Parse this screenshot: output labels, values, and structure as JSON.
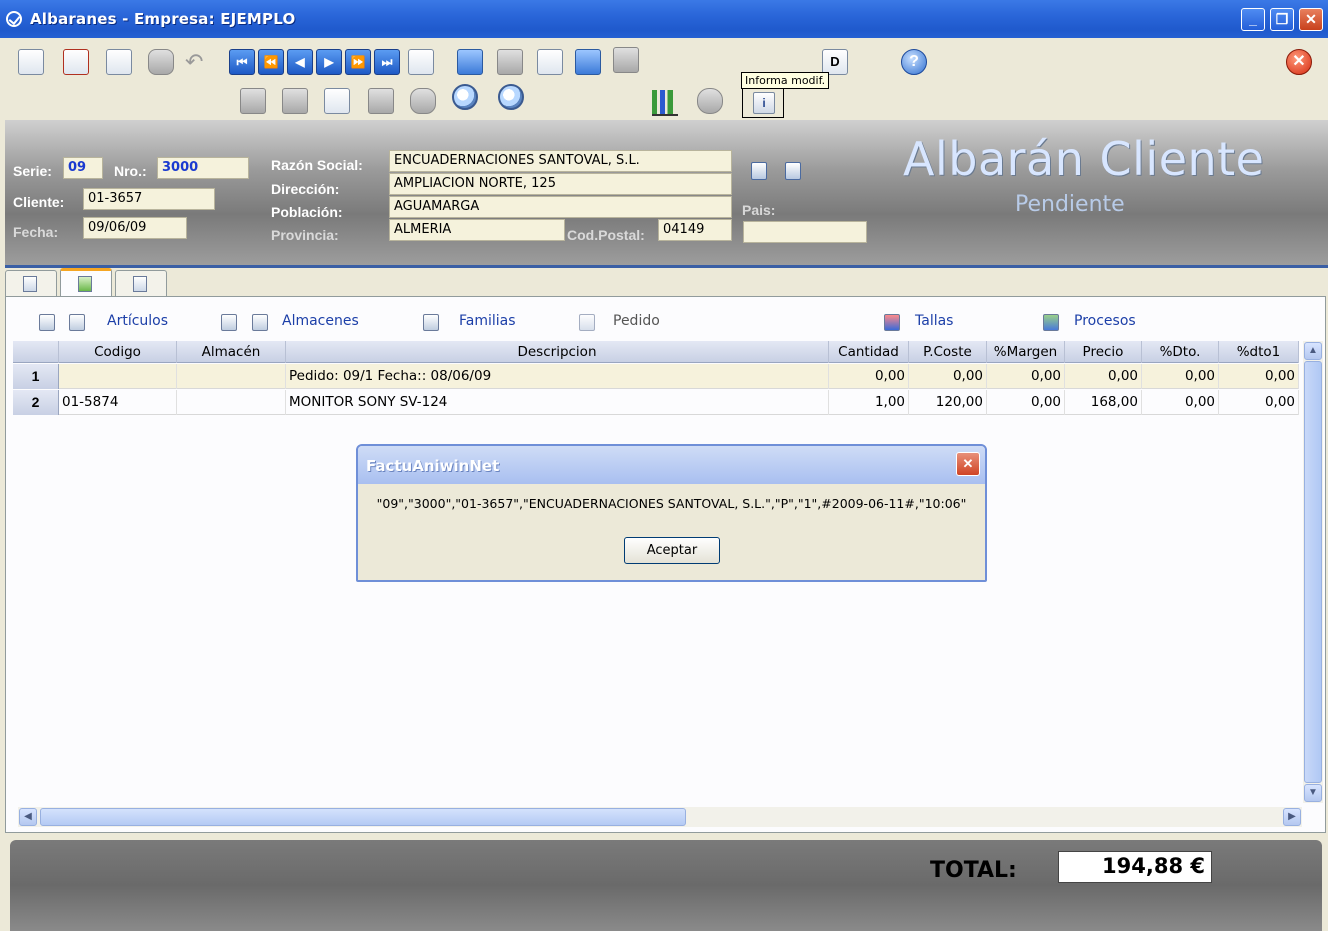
{
  "window": {
    "title": "Albaranes - Empresa: EJEMPLO",
    "minimize": "_",
    "restore": "❐",
    "close": "✕"
  },
  "toolbar": {
    "tooltip": "Informa modif.",
    "info_glyph": "i",
    "help_glyph": "?",
    "exit_glyph": "✕",
    "icons": [
      "new-doc-icon",
      "delete-doc-icon",
      "edit-doc-icon",
      "database-icon",
      "undo-icon",
      "first-record-icon",
      "previous-page-icon",
      "previous-record-icon",
      "next-record-icon",
      "next-page-icon",
      "last-record-icon",
      "eraser-icon",
      "window-icon",
      "printer-icon",
      "preview-icon",
      "report-icon",
      "link-icon",
      "doc-d-icon",
      "help-icon",
      "exit-icon",
      "add-line-icon",
      "grid-icon",
      "copy-icon",
      "paste-icon",
      "spellcheck-icon",
      "zoom-in-icon",
      "zoom-out-icon",
      "chart-icon",
      "info-icon"
    ]
  },
  "header": {
    "serie_label": "Serie:",
    "serie_value": "09",
    "nro_label": "Nro.:",
    "nro_value": "3000",
    "cliente_label": "Cliente:",
    "cliente_value": "01-3657",
    "fecha_label": "Fecha:",
    "fecha_value": "09/06/09",
    "razon_label": "Razón Social:",
    "razon_value": "ENCUADERNACIONES SANTOVAL, S.L.",
    "direccion_label": "Dirección:",
    "direccion_value": "AMPLIACION NORTE, 125",
    "poblacion_label": "Población:",
    "poblacion_value": "AGUAMARGA",
    "provincia_label": "Provincia:",
    "provincia_value": "ALMERIA",
    "codpostal_label": "Cod.Postal:",
    "codpostal_value": "04149",
    "pais_label": "Pais:",
    "pais_value": "",
    "doc_title": "Albarán Cliente",
    "doc_status": "Pendiente"
  },
  "links": {
    "articulos": "Artículos",
    "almacenes": "Almacenes",
    "familias": "Familias",
    "pedido": "Pedido",
    "tallas": "Tallas",
    "procesos": "Procesos"
  },
  "grid": {
    "columns": [
      "Codigo",
      "Almacén",
      "Descripcion",
      "Cantidad",
      "P.Coste",
      "%Margen",
      "Precio",
      "%Dto.",
      "%dto1"
    ],
    "rows": [
      {
        "num": "1",
        "codigo": "",
        "almacen": "",
        "descripcion": "Pedido: 09/1 Fecha:: 08/06/09",
        "cantidad": "0,00",
        "pcoste": "0,00",
        "margen": "0,00",
        "precio": "0,00",
        "dto": "0,00",
        "dto1": "0,00"
      },
      {
        "num": "2",
        "codigo": "01-5874",
        "almacen": "",
        "descripcion": "MONITOR SONY  SV-124",
        "cantidad": "1,00",
        "pcoste": "120,00",
        "margen": "0,00",
        "precio": "168,00",
        "dto": "0,00",
        "dto1": "0,00"
      }
    ]
  },
  "dialog": {
    "title": "FactuAniwinNet",
    "close": "✕",
    "message": "\"09\",\"3000\",\"01-3657\",\"ENCUADERNACIONES SANTOVAL, S.L.\",\"P\",\"1\",#2009-06-11#,\"10:06\"",
    "ok_label": "Aceptar"
  },
  "footer": {
    "total_label": "TOTAL:",
    "total_value": "194,88 €"
  },
  "scroll": {
    "up": "▲",
    "down": "▼",
    "left": "◀",
    "right": "▶"
  }
}
